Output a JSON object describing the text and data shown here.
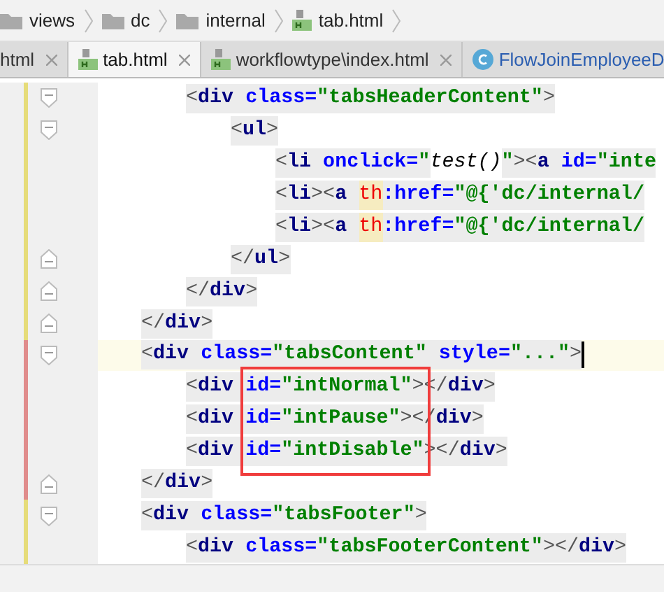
{
  "breadcrumb": [
    {
      "label": "views",
      "kind": "folder"
    },
    {
      "label": "dc",
      "kind": "folder"
    },
    {
      "label": "internal",
      "kind": "folder"
    },
    {
      "label": "tab.html",
      "kind": "html"
    }
  ],
  "tabs": [
    {
      "label": "html",
      "kind": "plain",
      "selected": false
    },
    {
      "label": "tab.html",
      "kind": "html",
      "selected": true
    },
    {
      "label": "workflowtype\\index.html",
      "kind": "html",
      "selected": false
    },
    {
      "label": "FlowJoinEmployeeD",
      "kind": "class",
      "selected": false
    }
  ],
  "lines": [
    {
      "children": [
        {
          "kind": "fold-start",
          "color": "#e6dc7a",
          "current": false,
          "tokens": [
            {
              "kind": "bracket",
              "text": "<"
            },
            {
              "kind": "tag",
              "text": "div"
            },
            {
              "kind": "attr",
              "text": " class="
            },
            {
              "kind": "value",
              "text": "\"tabsHeaderContent\""
            },
            {
              "kind": "bracket",
              "text": ">"
            }
          ],
          "children": [
            {
              "kind": "fold-start",
              "color": "#e6dc7a",
              "current": false,
              "tokens": [
                {
                  "kind": "bracket",
                  "text": "<"
                },
                {
                  "kind": "tag",
                  "text": "ul"
                },
                {
                  "kind": "bracket",
                  "text": ">"
                }
              ],
              "children": [
                {
                  "color": "#e6dc7a",
                  "current": false,
                  "tokens": [
                    {
                      "kind": "bracket",
                      "text": "<"
                    },
                    {
                      "kind": "tag",
                      "text": "li"
                    },
                    {
                      "kind": "attr",
                      "text": " onclick="
                    },
                    {
                      "kind": "value",
                      "text": "\""
                    },
                    {
                      "kind": "plain",
                      "text": "test()"
                    },
                    {
                      "kind": "value",
                      "text": "\""
                    },
                    {
                      "kind": "bracket",
                      "text": "><"
                    },
                    {
                      "kind": "tag",
                      "text": "a"
                    },
                    {
                      "kind": "attr",
                      "text": " id="
                    },
                    {
                      "kind": "value",
                      "text": "\"inte"
                    }
                  ]
                },
                {
                  "color": "#e6dc7a",
                  "current": false,
                  "tokens": [
                    {
                      "kind": "bracket",
                      "text": "<"
                    },
                    {
                      "kind": "tag",
                      "text": "li"
                    },
                    {
                      "kind": "bracket",
                      "text": "><"
                    },
                    {
                      "kind": "tag",
                      "text": "a "
                    },
                    {
                      "kind": "ns",
                      "text": "th"
                    },
                    {
                      "kind": "attr",
                      "text": ":href="
                    },
                    {
                      "kind": "value",
                      "text": "\"@{'dc/internal/"
                    }
                  ]
                },
                {
                  "color": "#e6dc7a",
                  "current": false,
                  "tokens": [
                    {
                      "kind": "bracket",
                      "text": "<"
                    },
                    {
                      "kind": "tag",
                      "text": "li"
                    },
                    {
                      "kind": "bracket",
                      "text": "><"
                    },
                    {
                      "kind": "tag",
                      "text": "a "
                    },
                    {
                      "kind": "ns",
                      "text": "th"
                    },
                    {
                      "kind": "attr",
                      "text": ":href="
                    },
                    {
                      "kind": "value",
                      "text": "\"@{'dc/internal/"
                    }
                  ]
                }
              ]
            },
            {
              "kind": "fold-end",
              "color": "#e6dc7a",
              "current": false,
              "tokens": [
                {
                  "kind": "bracket",
                  "text": "</"
                },
                {
                  "kind": "tag",
                  "text": "ul"
                },
                {
                  "kind": "bracket",
                  "text": ">"
                }
              ]
            }
          ]
        },
        {
          "kind": "fold-end",
          "color": "#e6dc7a",
          "current": false,
          "tokens": [
            {
              "kind": "bracket",
              "text": "</"
            },
            {
              "kind": "tag",
              "text": "div"
            },
            {
              "kind": "bracket",
              "text": ">"
            }
          ]
        }
      ]
    },
    {
      "kind": "fold-end",
      "color": "#e6dc7a",
      "current": false,
      "tokens": [
        {
          "kind": "bracket",
          "text": "</"
        },
        {
          "kind": "tag",
          "text": "div"
        },
        {
          "kind": "bracket",
          "text": ">"
        }
      ]
    },
    {
      "kind": "fold-start",
      "color": "#e08c8c",
      "current": true,
      "tokens": [
        {
          "kind": "bracket",
          "text": "<"
        },
        {
          "kind": "tag",
          "text": "div"
        },
        {
          "kind": "attr",
          "text": " class="
        },
        {
          "kind": "value",
          "text": "\"tabsContent\""
        },
        {
          "kind": "attr",
          "text": " style="
        },
        {
          "kind": "value",
          "text": "\"...\""
        },
        {
          "kind": "bracket",
          "text": ">"
        }
      ],
      "children": [
        {
          "color": "#e08c8c",
          "current": false,
          "tokens": [
            {
              "kind": "bracket",
              "text": "<"
            },
            {
              "kind": "tag",
              "text": "div"
            },
            {
              "kind": "attr",
              "text": " id="
            },
            {
              "kind": "value",
              "text": "\"intNormal\""
            },
            {
              "kind": "bracket",
              "text": "></"
            },
            {
              "kind": "tag",
              "text": "div"
            },
            {
              "kind": "bracket",
              "text": ">"
            }
          ]
        },
        {
          "color": "#e08c8c",
          "current": false,
          "tokens": [
            {
              "kind": "bracket",
              "text": "<"
            },
            {
              "kind": "tag",
              "text": "div"
            },
            {
              "kind": "attr",
              "text": " id="
            },
            {
              "kind": "value",
              "text": "\"intPause\""
            },
            {
              "kind": "bracket",
              "text": "></"
            },
            {
              "kind": "tag",
              "text": "div"
            },
            {
              "kind": "bracket",
              "text": ">"
            }
          ]
        },
        {
          "color": "#e08c8c",
          "current": false,
          "tokens": [
            {
              "kind": "bracket",
              "text": "<"
            },
            {
              "kind": "tag",
              "text": "div"
            },
            {
              "kind": "attr",
              "text": " id="
            },
            {
              "kind": "value",
              "text": "\"intDisable\""
            },
            {
              "kind": "bracket",
              "text": "></"
            },
            {
              "kind": "tag",
              "text": "div"
            },
            {
              "kind": "bracket",
              "text": ">"
            }
          ]
        }
      ]
    },
    {
      "kind": "fold-end",
      "color": "#e08c8c",
      "current": false,
      "tokens": [
        {
          "kind": "bracket",
          "text": "</"
        },
        {
          "kind": "tag",
          "text": "div"
        },
        {
          "kind": "bracket",
          "text": ">"
        }
      ]
    },
    {
      "kind": "fold-start",
      "color": "#e6dc7a",
      "current": false,
      "tokens": [
        {
          "kind": "bracket",
          "text": "<"
        },
        {
          "kind": "tag",
          "text": "div"
        },
        {
          "kind": "attr",
          "text": " class="
        },
        {
          "kind": "value",
          "text": "\"tabsFooter\""
        },
        {
          "kind": "bracket",
          "text": ">"
        }
      ],
      "children": [
        {
          "color": "#e6dc7a",
          "current": false,
          "tokens": [
            {
              "kind": "bracket",
              "text": "<"
            },
            {
              "kind": "tag",
              "text": "div"
            },
            {
              "kind": "attr",
              "text": " class="
            },
            {
              "kind": "value",
              "text": "\"tabsFooterContent\""
            },
            {
              "kind": "bracket",
              "text": "></"
            },
            {
              "kind": "tag",
              "text": "div"
            },
            {
              "kind": "bracket",
              "text": ">"
            }
          ]
        }
      ]
    }
  ]
}
